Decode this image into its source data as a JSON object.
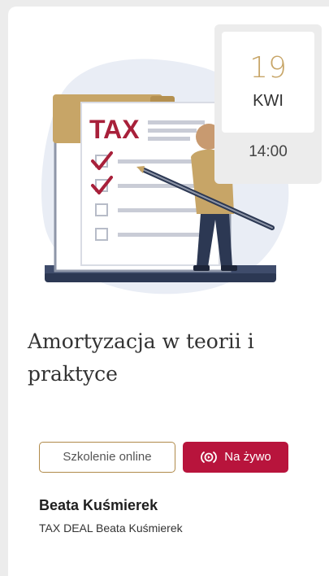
{
  "event": {
    "day": "19",
    "month": "KWI",
    "time": "14:00",
    "title": "Amortyzacja w teorii i praktyce",
    "illustration_text": "TAX"
  },
  "badges": {
    "online": "Szkolenie online",
    "live": "Na żywo",
    "live_icon": "live-broadcast-icon"
  },
  "speaker": {
    "name": "Beata Kuśmierek",
    "company": "TAX DEAL Beata Kuśmierek"
  },
  "colors": {
    "accent_gold": "#c7a567",
    "live_red": "#b8143c",
    "illustration_bg": "#e9edf5",
    "tax_red": "#a8203a"
  }
}
